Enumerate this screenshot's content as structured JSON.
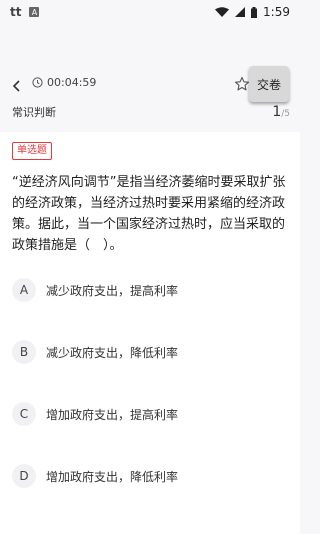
{
  "status_bar": {
    "time": "1:59",
    "app_icon_1": "tt",
    "app_icon_2": "A"
  },
  "header": {
    "timer": "00:04:59",
    "submit_label": "交卷"
  },
  "section": {
    "title": "常识判断",
    "current": "1",
    "total": "/5"
  },
  "question": {
    "type_label": "单选题",
    "stem": "“逆经济风向调节”是指当经济萎缩时要采取扩张的经济政策，当经济过热时要采用紧缩的经济政策。据此，当一个国家经济过热时，应当采取的政策措施是（　）。",
    "options": [
      {
        "letter": "A",
        "text": "减少政府支出，提高利率"
      },
      {
        "letter": "B",
        "text": "减少政府支出，降低利率"
      },
      {
        "letter": "C",
        "text": "增加政府支出，提高利率"
      },
      {
        "letter": "D",
        "text": "增加政府支出，降低利率"
      }
    ]
  },
  "colors": {
    "accent_red": "#e23a3a",
    "background": "#f7f7f9"
  }
}
